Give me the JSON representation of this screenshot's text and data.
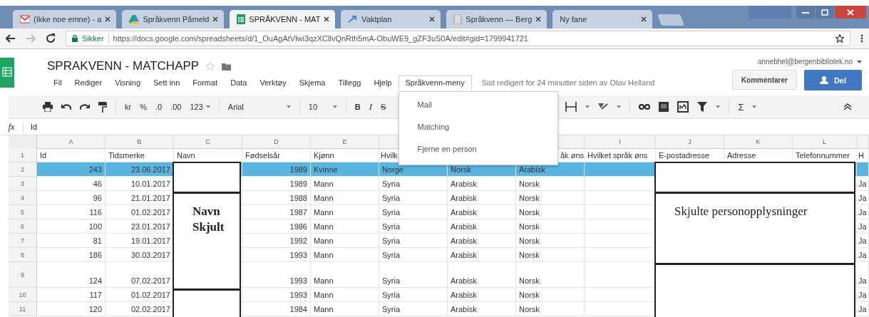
{
  "browser": {
    "tabs": [
      {
        "label": "(Ikke noe emne) - a",
        "selected": false
      },
      {
        "label": "Språkvenn Påmeld",
        "selected": false
      },
      {
        "label": "SPRÅKVENN - MAT",
        "selected": true
      },
      {
        "label": "Vaktplan",
        "selected": false
      },
      {
        "label": "Språkvenn — Berg",
        "selected": false
      },
      {
        "label": "Ny fane",
        "selected": false
      }
    ],
    "secure_label": "Sikker",
    "url": "https://docs.google.com/spreadsheets/d/1_OuAgAtVlwi3qzXCllvQnRth5mA-ObuWE9_gZF3uS0A/edit#gid=1799941721"
  },
  "header": {
    "title": "SPRAKVENN - MATCHAPP",
    "menus": [
      {
        "label": "Fil",
        "selected": false
      },
      {
        "label": "Rediger",
        "selected": false
      },
      {
        "label": "Visning",
        "selected": false
      },
      {
        "label": "Sett inn",
        "selected": false
      },
      {
        "label": "Format",
        "selected": false
      },
      {
        "label": "Data",
        "selected": false
      },
      {
        "label": "Verktøy",
        "selected": false
      },
      {
        "label": "Skjema",
        "selected": false
      },
      {
        "label": "Tillegg",
        "selected": false
      },
      {
        "label": "Hjelp",
        "selected": false
      },
      {
        "label": "Språkvenn-meny",
        "selected": true
      }
    ],
    "last_edit": "Sist redigert for 24 minutter siden av Olav Helland",
    "account": "annebhel@bergenbibliotek.no",
    "comments_button": "Kommentarer",
    "share_button": "Del"
  },
  "open_menu": {
    "items": [
      "Mail",
      "Matching",
      "Fjerne en person"
    ]
  },
  "toolbar": {
    "number_buttons": [
      "kr",
      "%",
      ".0",
      ".00"
    ],
    "number_format": "123",
    "font": "Arial",
    "font_size": "10",
    "format_buttons": [
      "B",
      "I",
      "S"
    ],
    "functions": "Σ"
  },
  "formula_bar": {
    "label": "fx",
    "value": "Id"
  },
  "sheet": {
    "columns": [
      "A",
      "B",
      "C",
      "D",
      "E",
      null,
      null,
      null,
      "I",
      "J",
      "K",
      "L",
      null
    ],
    "rows": [
      {
        "number": "1",
        "kind": "header",
        "selected": false,
        "tall": false,
        "cells": [
          "Id",
          "Tidsmerke",
          "Navn",
          "Fødselsår",
          "Kjønn",
          "Hvilk",
          null,
          "åk øns",
          "Hvilket språk øns",
          "E-postadresse",
          "Adresse",
          "Telefonnummer",
          "H"
        ]
      },
      {
        "number": "2",
        "kind": "data",
        "selected": true,
        "tall": false,
        "cells": [
          "243",
          "23.06.2017",
          null,
          "1989",
          "Kvinne",
          "Norge",
          "Norsk",
          "Arabisk",
          null,
          null,
          null,
          null,
          null
        ]
      },
      {
        "number": "3",
        "kind": "data",
        "selected": false,
        "tall": false,
        "cells": [
          "46",
          "10.01.2017",
          null,
          "1989",
          "Mann",
          "Syria",
          "Arabisk",
          "Norsk",
          null,
          null,
          null,
          null,
          "Ja"
        ]
      },
      {
        "number": "4",
        "kind": "data",
        "selected": false,
        "tall": false,
        "cells": [
          "96",
          "21.01.2017",
          null,
          "1988",
          "Mann",
          "Syria",
          "Arabisk",
          "Norsk",
          null,
          null,
          null,
          null,
          "Ja"
        ]
      },
      {
        "number": "5",
        "kind": "data",
        "selected": false,
        "tall": false,
        "cells": [
          "116",
          "01.02.2017",
          null,
          "1987",
          "Mann",
          "Syria",
          "Arabisk",
          "Norsk",
          null,
          null,
          null,
          null,
          "Ja"
        ]
      },
      {
        "number": "6",
        "kind": "data",
        "selected": false,
        "tall": false,
        "cells": [
          "100",
          "23.01.2017",
          null,
          "1986",
          "Mann",
          "Syria",
          "Arabisk",
          "Norsk",
          null,
          null,
          null,
          null,
          "Ja"
        ]
      },
      {
        "number": "7",
        "kind": "data",
        "selected": false,
        "tall": false,
        "cells": [
          "81",
          "19.01.2017",
          null,
          "1992",
          "Mann",
          "Syria",
          "Arabisk",
          "Norsk",
          null,
          null,
          null,
          null,
          "Ja"
        ]
      },
      {
        "number": "8",
        "kind": "data",
        "selected": false,
        "tall": false,
        "cells": [
          "186",
          "30.03.2017",
          null,
          "1993",
          "Mann",
          "Syria",
          "Arabisk",
          "Norsk",
          null,
          null,
          null,
          null,
          "Ja"
        ]
      },
      {
        "number": "9",
        "kind": "data",
        "selected": false,
        "tall": true,
        "cells": [
          "124",
          "07.02.2017",
          null,
          "1993",
          "Mann",
          "Syria",
          "Arabisk",
          "Norsk",
          null,
          null,
          null,
          null,
          "Ja"
        ]
      },
      {
        "number": "10",
        "kind": "data",
        "selected": false,
        "tall": false,
        "cells": [
          "117",
          "01.02.2017",
          null,
          "1993",
          "Mann",
          "Syria",
          "Arabisk",
          "Norsk",
          null,
          null,
          null,
          null,
          "Ja"
        ]
      },
      {
        "number": "11",
        "kind": "data",
        "selected": false,
        "tall": false,
        "cells": [
          "120",
          "02.02.2017",
          null,
          "1984",
          "Mann",
          "Syria",
          "Arabisk",
          "Norsk",
          null,
          null,
          null,
          null,
          "Ja"
        ]
      }
    ]
  },
  "redaction_boxes": [
    {
      "text": "Navn Skjult"
    },
    {
      "text": "Skjulte personopplysninger"
    }
  ]
}
